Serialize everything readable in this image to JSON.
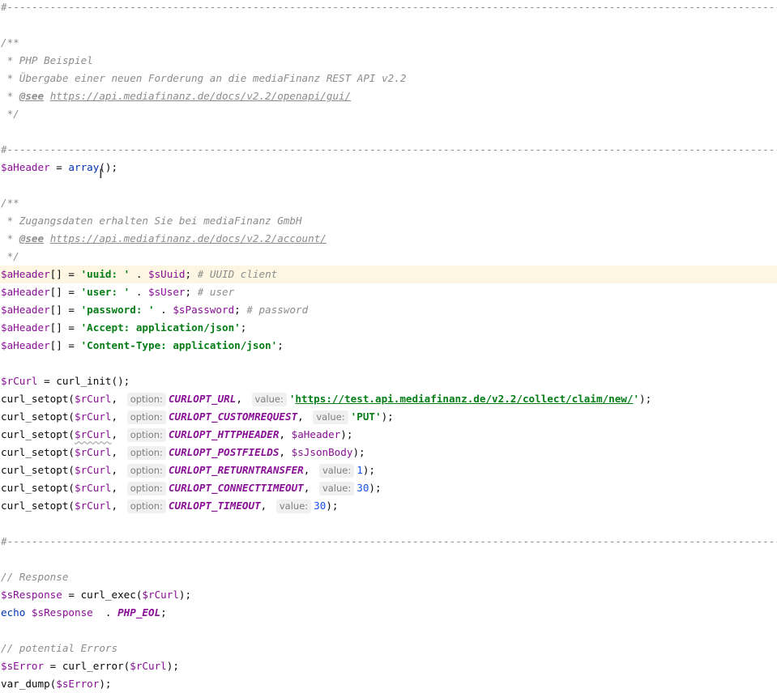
{
  "editor": {
    "separator": "#-------------------------------------------------------------------------------------------------------------------------------------------------",
    "doc1": {
      "open": "/**",
      "line1": " * PHP Beispiel",
      "line2": " * Übergabe einer neuen Forderung an die mediaFinanz REST API v2.2",
      "see_prefix": " * ",
      "see_tag": "@see",
      "see_url": "https://api.mediafinanz.de/docs/v2.2/openapi/gui/",
      "close": " */"
    },
    "header_init": {
      "var": "$aHeader",
      "op": " = ",
      "fn": "array",
      "tail": "();"
    },
    "doc2": {
      "open": "/**",
      "line1": " * Zugangsdaten erhalten Sie bei mediaFinanz GmbH",
      "see_prefix": " * ",
      "see_tag": "@see",
      "see_url": "https://api.mediafinanz.de/docs/v2.2/account/",
      "close": " */"
    },
    "header_lines": [
      {
        "var": "$aHeader",
        "mid": "[] = ",
        "str": "'uuid: '",
        "concat": " . ",
        "var2": "$sUuid",
        "end": ";",
        "comment": " # UUID client"
      },
      {
        "var": "$aHeader",
        "mid": "[] = ",
        "str": "'user: '",
        "concat": " . ",
        "var2": "$sUser",
        "end": ";",
        "comment": " # user"
      },
      {
        "var": "$aHeader",
        "mid": "[] = ",
        "str": "'password: '",
        "concat": " . ",
        "var2": "$sPassword",
        "end": ";",
        "comment": " # password"
      },
      {
        "var": "$aHeader",
        "mid": "[] = ",
        "str": "'Accept: application/json'",
        "end": ";"
      },
      {
        "var": "$aHeader",
        "mid": "[] = ",
        "str": "'Content-Type: application/json'",
        "end": ";"
      }
    ],
    "curl_init": {
      "var": "$rCurl",
      "op": " = ",
      "fn": "curl_init",
      "tail": "();"
    },
    "setopt": {
      "fn": "curl_setopt(",
      "var": "$rCurl",
      "comma": ",",
      "option_hint": "option:",
      "value_hint": "value:",
      "close": ");"
    },
    "setopt_lines": [
      {
        "const": "CURLOPT_URL",
        "value_type": "str_link",
        "value_quote_open": "'",
        "value": "https://test.api.mediafinanz.de/v2.2/collect/claim/new/",
        "value_quote_close": "'"
      },
      {
        "const": "CURLOPT_CUSTOMREQUEST",
        "value_type": "str",
        "value": "'PUT'"
      },
      {
        "const": "CURLOPT_HTTPHEADER",
        "value_type": "var",
        "value": "$aHeader"
      },
      {
        "const": "CURLOPT_POSTFIELDS",
        "value_type": "var",
        "value": "$sJsonBody"
      },
      {
        "const": "CURLOPT_RETURNTRANSFER",
        "value_type": "num",
        "value": "1"
      },
      {
        "const": "CURLOPT_CONNECTTIMEOUT",
        "value_type": "num",
        "value": "30"
      },
      {
        "const": "CURLOPT_TIMEOUT",
        "value_type": "num",
        "value": "30"
      }
    ],
    "response_comment": "// Response",
    "response_line": {
      "var": "$sResponse",
      "op": " = ",
      "fn": "curl_exec(",
      "arg": "$rCurl",
      "tail": ");"
    },
    "echo_line": {
      "kw": "echo",
      "var": " $sResponse",
      "concat": "  . ",
      "const": "PHP_EOL",
      "end": ";"
    },
    "errors_comment": "// potential Errors",
    "error_line": {
      "var": "$sError",
      "op": " = ",
      "fn": "curl_error(",
      "arg": "$rCurl",
      "tail": ");"
    },
    "dump_line": {
      "fn": "var_dump(",
      "arg": "$sError",
      "tail": ");"
    },
    "cursor_glyph": "I"
  }
}
